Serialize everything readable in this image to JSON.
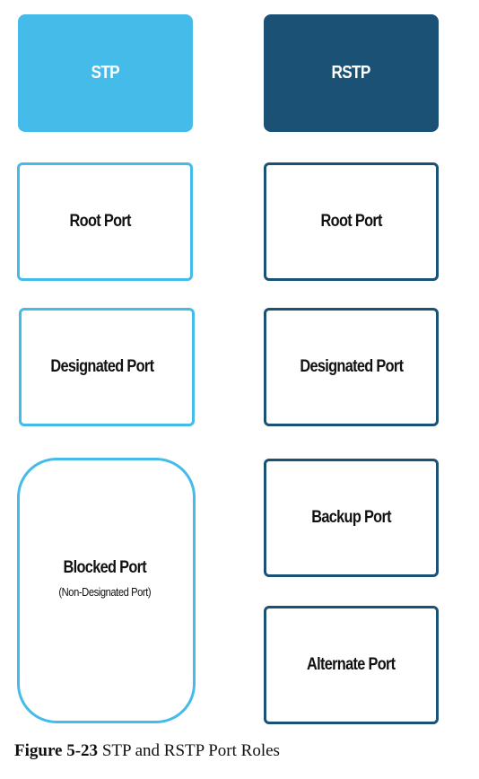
{
  "stp": {
    "header": "STP",
    "roles": {
      "root": "Root Port",
      "designated": "Designated Port",
      "blocked": "Blocked Port",
      "blocked_note": "(Non-Designated Port)"
    }
  },
  "rstp": {
    "header": "RSTP",
    "roles": {
      "root": "Root Port",
      "designated": "Designated Port",
      "backup": "Backup Port",
      "alternate": "Alternate Port"
    }
  },
  "caption": {
    "figure_number": "Figure 5-23",
    "text": "STP and RSTP Port Roles"
  },
  "colors": {
    "stp": "#45bbea",
    "rstp": "#1a5175"
  }
}
